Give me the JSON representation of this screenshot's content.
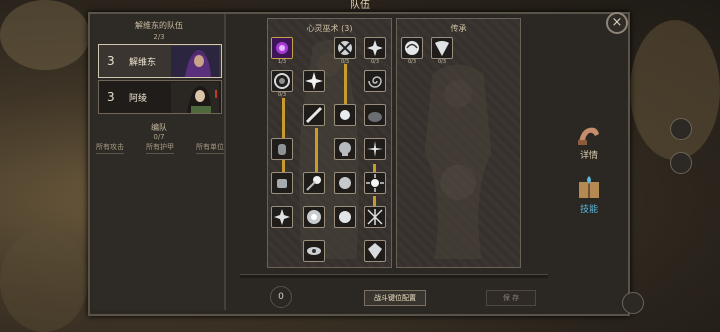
{
  "window": {
    "title": "队伍",
    "close_label": "×"
  },
  "team": {
    "title": "解维东的队伍",
    "count": "2/3",
    "members": [
      {
        "level": "3",
        "name": "解维东",
        "selected": true
      },
      {
        "level": "3",
        "name": "阿绫",
        "selected": false
      }
    ]
  },
  "formation": {
    "title": "编队",
    "count": "0/7",
    "filters": [
      "所有攻击",
      "所有护甲",
      "所有单位"
    ]
  },
  "trees": {
    "left_title": "心灵巫术 (3)",
    "right_title": "传承",
    "node_labels": [
      "1/3",
      "0/3",
      "0/3",
      "0/3",
      "0/3",
      "0/3"
    ]
  },
  "footer": {
    "points": "0",
    "config_button": "战斗键位配置",
    "save_button": "保 存"
  },
  "side_tabs": [
    {
      "label": "详情",
      "icon": "arm-icon"
    },
    {
      "label": "技能",
      "icon": "book-icon"
    }
  ],
  "colors": {
    "accent_link": "#c99a2e",
    "selected_tab": "#5fb6d6"
  }
}
